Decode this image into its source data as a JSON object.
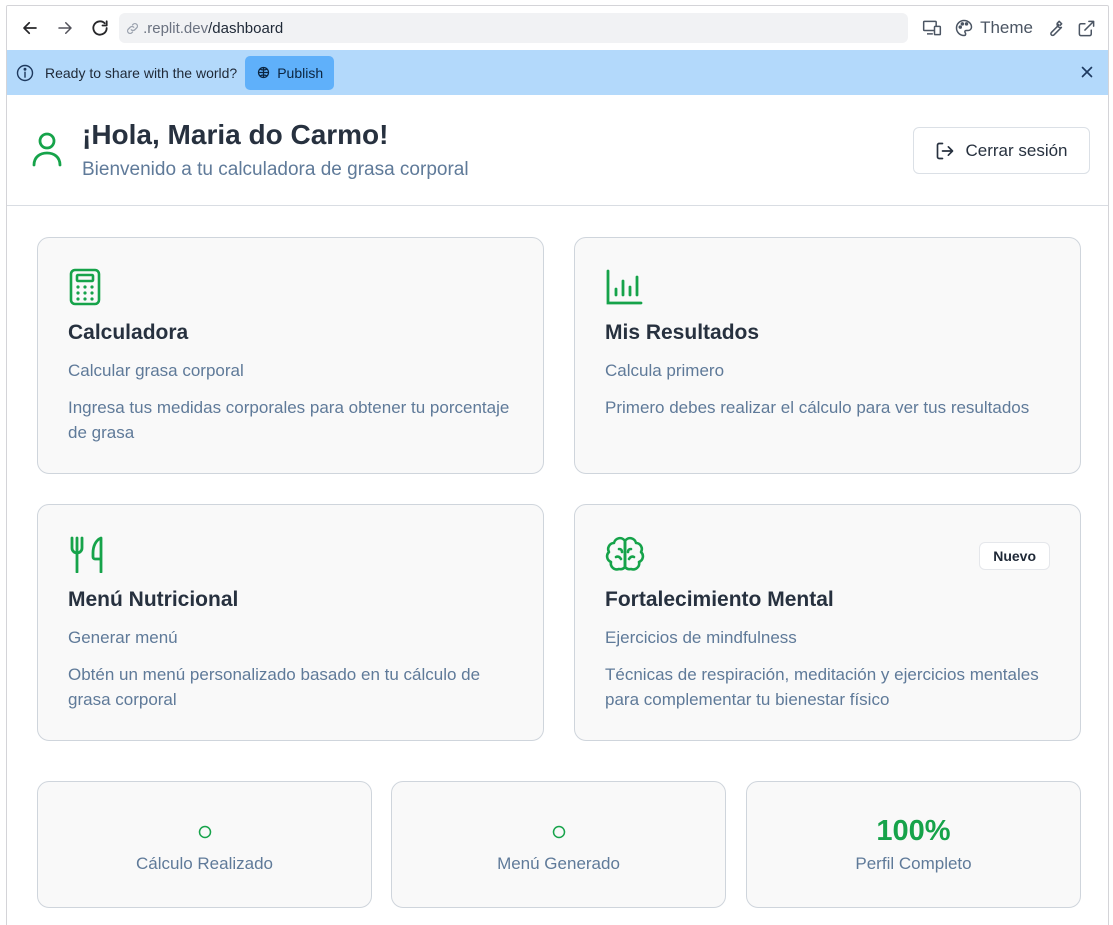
{
  "browser": {
    "url_host": ".replit.dev",
    "url_path": "/dashboard",
    "theme_label": "Theme"
  },
  "banner": {
    "message": "Ready to share with the world?",
    "publish_label": "Publish"
  },
  "header": {
    "greeting": "¡Hola, Maria do Carmo!",
    "subtitle": "Bienvenido a tu calculadora de grasa corporal",
    "logout_label": "Cerrar sesión"
  },
  "cards": [
    {
      "icon": "calculator-icon",
      "title": "Calculadora",
      "subtitle": "Calcular grasa corporal",
      "description": "Ingresa tus medidas corporales para obtener tu porcentaje de grasa"
    },
    {
      "icon": "bar-chart-icon",
      "title": "Mis Resultados",
      "subtitle": "Calcula primero",
      "description": "Primero debes realizar el cálculo para ver tus resultados"
    },
    {
      "icon": "utensils-icon",
      "title": "Menú Nutricional",
      "subtitle": "Generar menú",
      "description": "Obtén un menú personalizado basado en tu cálculo de grasa corporal"
    },
    {
      "icon": "brain-icon",
      "title": "Fortalecimiento Mental",
      "subtitle": "Ejercicios de mindfulness",
      "description": "Técnicas de respiración, meditación y ejercicios mentales para complementar tu bienestar físico",
      "badge": "Nuevo"
    }
  ],
  "stats": [
    {
      "icon": "circle-icon",
      "label": "Cálculo Realizado"
    },
    {
      "icon": "circle-icon",
      "label": "Menú Generado"
    },
    {
      "value": "100%",
      "label": "Perfil Completo"
    }
  ],
  "colors": {
    "accent_green": "#16a34a",
    "banner_bg": "#b3d9fb",
    "publish_bg": "#5fb0fa",
    "card_bg": "#f9f9f9",
    "muted_text": "#5f7a99"
  }
}
